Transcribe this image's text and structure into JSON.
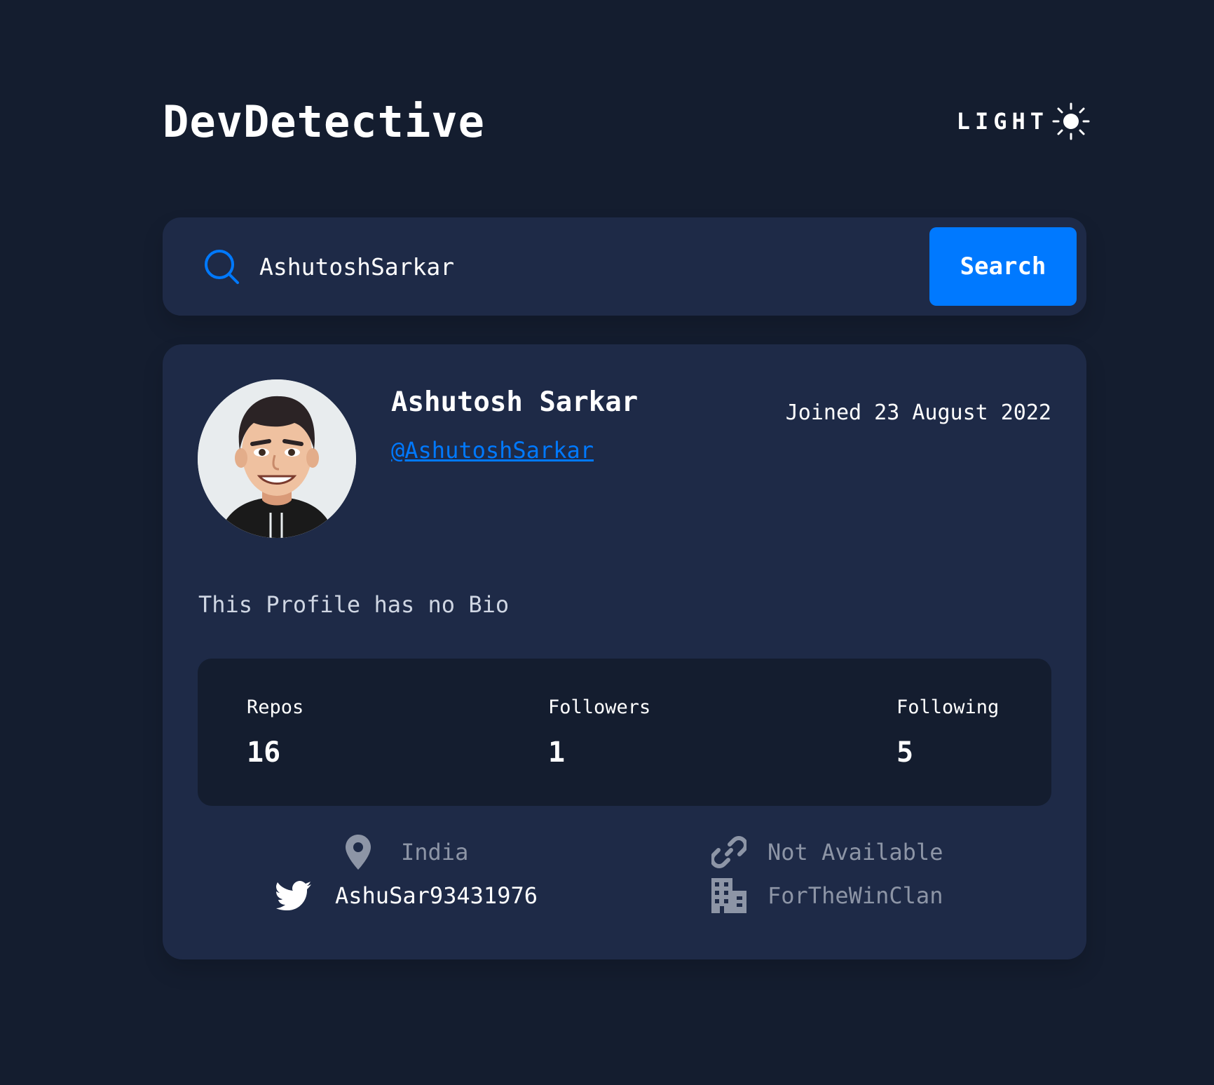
{
  "app": {
    "title": "DevDetective"
  },
  "theme": {
    "label": "LIGHT",
    "icon": "sun-icon"
  },
  "search": {
    "value": "AshutoshSarkar",
    "button_label": "Search"
  },
  "profile": {
    "name": "Ashutosh Sarkar",
    "login": "@AshutoshSarkar",
    "joined": "Joined 23 August 2022",
    "bio": "This Profile has no Bio"
  },
  "stats": [
    {
      "label": "Repos",
      "value": "16"
    },
    {
      "label": "Followers",
      "value": "1"
    },
    {
      "label": "Following",
      "value": "5"
    }
  ],
  "links": {
    "location": "India",
    "website": "Not Available",
    "twitter": "AshuSar93431976",
    "company": "ForTheWinClan"
  },
  "colors": {
    "background": "#141d2f",
    "card": "#1e2a47",
    "accent": "#0079ff",
    "muted": "#8d95a6"
  }
}
